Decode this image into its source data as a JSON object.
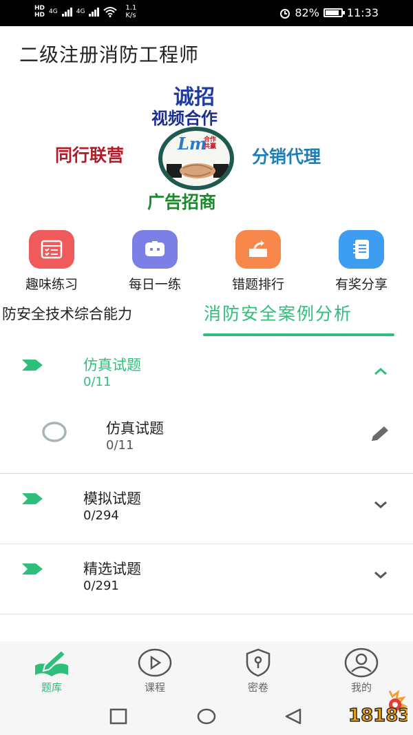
{
  "status_bar": {
    "hd_top": "HD",
    "hd_bottom": "HD",
    "net1": "4G",
    "net2": "4G",
    "speed_value": "1.1",
    "speed_unit": "K/s",
    "alarm_icon": "alarm-icon",
    "battery_pct": "82%",
    "time": "11:33"
  },
  "app_title": "二级注册消防工程师",
  "banner": {
    "recruit": "诚招",
    "video": "视频合作",
    "peer": "同行联营",
    "distribution": "分销代理",
    "ads": "广告招商",
    "logo_mark": "Lm",
    "logo_tag_1": "合作",
    "logo_tag_2": "共赢"
  },
  "shortcuts": [
    {
      "label": "趣味练习",
      "icon": "checklist-icon",
      "color": "#ef5b5b"
    },
    {
      "label": "每日一练",
      "icon": "robot-icon",
      "color": "#7b7fe6"
    },
    {
      "label": "错题排行",
      "icon": "share-box-icon",
      "color": "#f7874a"
    },
    {
      "label": "有奖分享",
      "icon": "notebook-icon",
      "color": "#3d9df0"
    }
  ],
  "tabs": [
    {
      "label": "防安全技术综合能力",
      "active": false
    },
    {
      "label": "消防安全案例分析",
      "active": true
    }
  ],
  "categories": [
    {
      "title": "仿真试题",
      "count": "0/11",
      "expanded": true,
      "sub": {
        "title": "仿真试题",
        "count": "0/11"
      }
    },
    {
      "title": "模拟试题",
      "count": "0/294",
      "expanded": false
    },
    {
      "title": "精选试题",
      "count": "0/291",
      "expanded": false
    }
  ],
  "bottom_nav": [
    {
      "label": "题库",
      "icon": "book-pen-icon",
      "active": true
    },
    {
      "label": "课程",
      "icon": "play-circle-icon",
      "active": false
    },
    {
      "label": "密卷",
      "icon": "shield-lock-icon",
      "active": false
    },
    {
      "label": "我的",
      "icon": "user-icon",
      "active": false
    }
  ],
  "watermark": "18183",
  "colors": {
    "accent": "#2ec07b",
    "text": "#222222",
    "muted": "#666666"
  }
}
